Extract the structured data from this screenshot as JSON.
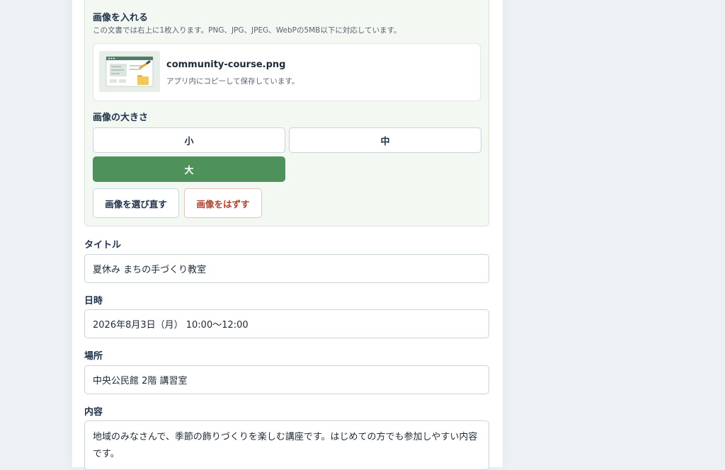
{
  "image_section": {
    "title": "画像を入れる",
    "note": "この文書では右上に1枚入ります。PNG、JPG、JPEG、WebPの5MB以下に対応しています。",
    "file_name": "community-course.png",
    "file_note": "アプリ内にコピーして保存しています。",
    "size_label": "画像の大きさ",
    "sizes": [
      "小",
      "中",
      "大"
    ],
    "selected_size": "大",
    "reselect_label": "画像を選び直す",
    "remove_label": "画像をはずす"
  },
  "fields": {
    "title_label": "タイトル",
    "title_value": "夏休み まちの手づくり教室",
    "datetime_label": "日時",
    "datetime_value": "2026年8月3日（月） 10:00〜12:00",
    "place_label": "場所",
    "place_value": "中央公民館 2階 講習室",
    "content_label": "内容",
    "content_value": "地域のみなさんで、季節の飾りづくりを楽しむ講座です。はじめての方でも参加しやすい内容です。"
  },
  "colors": {
    "accent_green": "#4f915a",
    "danger_red": "#b0402f",
    "heading_navy": "#20324a"
  }
}
